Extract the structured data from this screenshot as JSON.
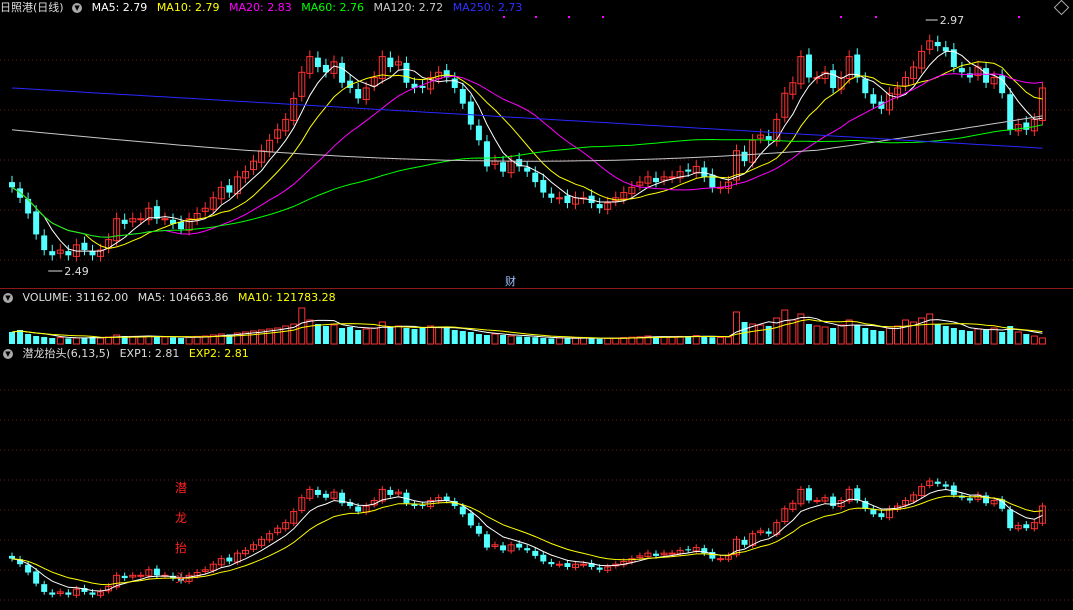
{
  "main": {
    "title": "日照港(日线)",
    "ma5": "MA5: 2.79",
    "ma10": "MA10: 2.79",
    "ma20": "MA20: 2.83",
    "ma60": "MA60: 2.76",
    "ma120": "MA120: 2.72",
    "ma250": "MA250: 2.73",
    "high_label": "2.97",
    "low_label": "2.49",
    "marker": "财"
  },
  "volume_panel": {
    "volume": "VOLUME: 31162.00",
    "ma5": "MA5: 104663.86",
    "ma10": "MA10: 121783.28"
  },
  "indicator_panel": {
    "name": "潜龙抬头(6,13,5)",
    "exp1": "EXP1: 2.81",
    "exp2": "EXP2: 2.81",
    "vertical_text": [
      "潜",
      "龙",
      "抬",
      "头"
    ]
  },
  "colors": {
    "up": "#ff3232",
    "down": "#54ffff",
    "ma5": "#ffffff",
    "ma10": "#ffff00",
    "ma20": "#ff00ff",
    "ma60": "#00ff00",
    "ma120": "#c8c8c8",
    "ma250": "#2828ff",
    "exp1": "#ffffff",
    "exp2": "#ffff00",
    "title_red": "#ff2020"
  },
  "chart_data": {
    "type": "candlestick",
    "y_range": [
      2.49,
      2.97
    ],
    "close": [
      2.65,
      2.63,
      2.6,
      2.56,
      2.53,
      2.52,
      2.53,
      2.52,
      2.54,
      2.53,
      2.52,
      2.53,
      2.55,
      2.59,
      2.58,
      2.59,
      2.59,
      2.61,
      2.59,
      2.59,
      2.58,
      2.57,
      2.59,
      2.6,
      2.61,
      2.63,
      2.65,
      2.64,
      2.67,
      2.68,
      2.7,
      2.72,
      2.74,
      2.76,
      2.78,
      2.82,
      2.87,
      2.9,
      2.88,
      2.87,
      2.89,
      2.85,
      2.84,
      2.82,
      2.84,
      2.86,
      2.9,
      2.88,
      2.89,
      2.85,
      2.84,
      2.84,
      2.86,
      2.87,
      2.86,
      2.84,
      2.81,
      2.77,
      2.74,
      2.69,
      2.7,
      2.68,
      2.7,
      2.69,
      2.68,
      2.66,
      2.64,
      2.63,
      2.63,
      2.62,
      2.63,
      2.63,
      2.62,
      2.61,
      2.62,
      2.63,
      2.64,
      2.65,
      2.66,
      2.67,
      2.66,
      2.67,
      2.67,
      2.68,
      2.68,
      2.69,
      2.67,
      2.65,
      2.65,
      2.66,
      2.72,
      2.7,
      2.74,
      2.75,
      2.74,
      2.78,
      2.83,
      2.85,
      2.9,
      2.86,
      2.86,
      2.87,
      2.84,
      2.86,
      2.9,
      2.86,
      2.83,
      2.81,
      2.8,
      2.83,
      2.84,
      2.86,
      2.88,
      2.91,
      2.93,
      2.92,
      2.91,
      2.88,
      2.87,
      2.86,
      2.88,
      2.85,
      2.86,
      2.83,
      2.76,
      2.77,
      2.76,
      2.78,
      2.84
    ],
    "volume": [
      60,
      70,
      50,
      40,
      35,
      30,
      32,
      28,
      30,
      32,
      35,
      30,
      35,
      45,
      40,
      38,
      36,
      40,
      38,
      35,
      33,
      30,
      34,
      38,
      40,
      45,
      50,
      48,
      55,
      60,
      65,
      70,
      75,
      80,
      90,
      100,
      180,
      120,
      100,
      90,
      95,
      80,
      85,
      70,
      75,
      80,
      110,
      85,
      90,
      80,
      75,
      80,
      90,
      85,
      80,
      70,
      65,
      60,
      50,
      45,
      50,
      45,
      40,
      38,
      36,
      34,
      30,
      28,
      30,
      28,
      30,
      32,
      28,
      26,
      28,
      30,
      32,
      34,
      36,
      40,
      38,
      36,
      34,
      38,
      40,
      42,
      38,
      34,
      33,
      35,
      160,
      110,
      100,
      95,
      90,
      130,
      170,
      120,
      150,
      100,
      90,
      85,
      80,
      95,
      120,
      95,
      80,
      70,
      65,
      80,
      90,
      120,
      110,
      130,
      150,
      100,
      90,
      80,
      70,
      65,
      75,
      70,
      80,
      60,
      90,
      60,
      50,
      40,
      30
    ],
    "volume_unit": "relative",
    "exp1_label": "EXP1: 2.81",
    "exp2_label": "EXP2: 2.81"
  }
}
